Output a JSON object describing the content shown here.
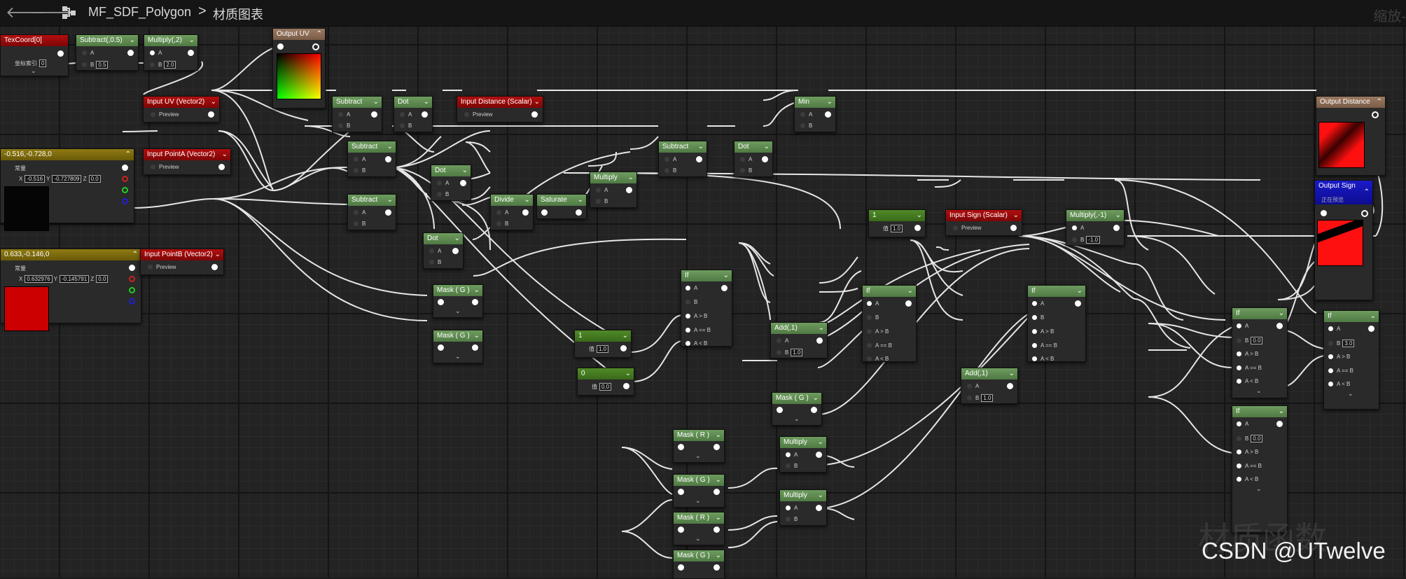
{
  "toolbar": {
    "back_icon": "arrow-left-icon",
    "forward_icon": "arrow-right-icon",
    "graph_icon": "graph-icon",
    "asset_name": "MF_SDF_Polygon",
    "separator": ">",
    "current_view": "材质图表",
    "zoom_text": "缩放-"
  },
  "nodes": {
    "texcoord": {
      "title": "TexCoord[0]",
      "label": "坐标索引",
      "value": "0"
    },
    "subtract_05": {
      "title": "Subtract(,0.5)",
      "pin_a": "A",
      "pin_b": "B",
      "b_value": "0.5"
    },
    "multiply_2": {
      "title": "Multiply(,2)",
      "pin_a": "A",
      "pin_b": "B",
      "b_value": "2.0"
    },
    "output_uv": {
      "title": "Output UV"
    },
    "input_uv": {
      "title": "Input UV (Vector2)",
      "pin": "Preview"
    },
    "const_a": {
      "title": "-0.516,-0.728,0",
      "label": "常量",
      "x_label": "X",
      "x": "-0.516",
      "y_label": "Y",
      "y": "-0.727809",
      "z_label": "Z",
      "z": "0.0"
    },
    "input_point_a": {
      "title": "Input PointA (Vector2)",
      "pin": "Preview"
    },
    "const_b": {
      "title": "0.633,-0.146,0",
      "label": "常量",
      "x_label": "X",
      "x": "0.632976",
      "y_label": "Y",
      "y": "-0.145791",
      "z_label": "Z",
      "z": "0.0"
    },
    "input_point_b": {
      "title": "Input PointB (Vector2)",
      "pin": "Preview"
    },
    "subtract1": {
      "title": "Subtract",
      "pin_a": "A",
      "pin_b": "B"
    },
    "dot1": {
      "title": "Dot",
      "pin_a": "A",
      "pin_b": "B"
    },
    "input_distance": {
      "title": "Input Distance (Scalar)",
      "pin": "Preview"
    },
    "min": {
      "title": "Min",
      "pin_a": "A",
      "pin_b": "B"
    },
    "output_distance": {
      "title": "Output Distance"
    },
    "subtract2": {
      "title": "Subtract",
      "pin_a": "A",
      "pin_b": "B"
    },
    "dot2": {
      "title": "Dot",
      "pin_a": "A",
      "pin_b": "B"
    },
    "subtract3": {
      "title": "Subtract",
      "pin_a": "A",
      "pin_b": "B"
    },
    "dot3": {
      "title": "Dot",
      "pin_a": "A",
      "pin_b": "B"
    },
    "subtract4": {
      "title": "Subtract",
      "pin_a": "A",
      "pin_b": "B"
    },
    "dot4": {
      "title": "Dot",
      "pin_a": "A",
      "pin_b": "B"
    },
    "multiply1": {
      "title": "Multiply",
      "pin_a": "A",
      "pin_b": "B"
    },
    "divide": {
      "title": "Divide",
      "pin_a": "A",
      "pin_b": "B"
    },
    "saturate": {
      "title": "Saturate"
    },
    "mask_g1": {
      "title": "Mask ( G )"
    },
    "mask_g2": {
      "title": "Mask ( G )"
    },
    "const_1": {
      "title": "1",
      "label": "值",
      "value": "1.0"
    },
    "const_0": {
      "title": "0",
      "label": "值",
      "value": "0.0"
    },
    "if1": {
      "title": "If",
      "pins": [
        "A",
        "B",
        "A > B",
        "A == B",
        "A < B"
      ]
    },
    "add1": {
      "title": "Add(,1)",
      "pin_a": "A",
      "pin_b": "B",
      "b_value": "1.0"
    },
    "mask_g3": {
      "title": "Mask ( G )"
    },
    "mask_r1": {
      "title": "Mask ( R )"
    },
    "mask_g4": {
      "title": "Mask ( G )"
    },
    "mask_r2": {
      "title": "Mask ( R )"
    },
    "mask_g5": {
      "title": "Mask ( G )"
    },
    "multiply2": {
      "title": "Multiply",
      "pin_a": "A",
      "pin_b": "B"
    },
    "multiply3": {
      "title": "Multiply",
      "pin_a": "A",
      "pin_b": "B"
    },
    "const_1b": {
      "title": "1",
      "label": "值",
      "value": "1.0"
    },
    "input_sign": {
      "title": "Input Sign (Scalar)",
      "pin": "Preview"
    },
    "multiply_neg1": {
      "title": "Multiply(,-1)",
      "pin_a": "A",
      "pin_b": "B",
      "b_value": "-1.0"
    },
    "if2": {
      "title": "If",
      "pins": [
        "A",
        "B",
        "A > B",
        "A == B",
        "A < B"
      ]
    },
    "add2": {
      "title": "Add(,1)",
      "pin_a": "A",
      "pin_b": "B",
      "b_value": "1.0"
    },
    "if3": {
      "title": "If",
      "pins": [
        "A",
        "B",
        "A > B",
        "A == B",
        "A < B"
      ]
    },
    "if4": {
      "title": "If",
      "pins": [
        "A",
        "B",
        "A > B",
        "A == B",
        "A < B"
      ],
      "b_value": "0.0"
    },
    "if5": {
      "title": "If",
      "pins": [
        "A",
        "B",
        "A > B",
        "A == B",
        "A < B"
      ],
      "b_value": "0.0"
    },
    "output_sign": {
      "title": "Output Sign",
      "subtitle": "正在预览"
    },
    "if6": {
      "title": "If",
      "pins": [
        "A",
        "B",
        "A > B",
        "A == B",
        "A < B"
      ],
      "b_value": "3.0"
    }
  },
  "colors": {
    "accent_green": "#5b8a4e",
    "input_red": "#a00c0c",
    "output_brown": "#8b6b55",
    "const_olive": "#7d6a0e",
    "preview_blue": "#1414b4",
    "swatch_red": "#d00000"
  },
  "watermark": {
    "faint": "材质函数",
    "credit": "CSDN @UTwelve"
  }
}
